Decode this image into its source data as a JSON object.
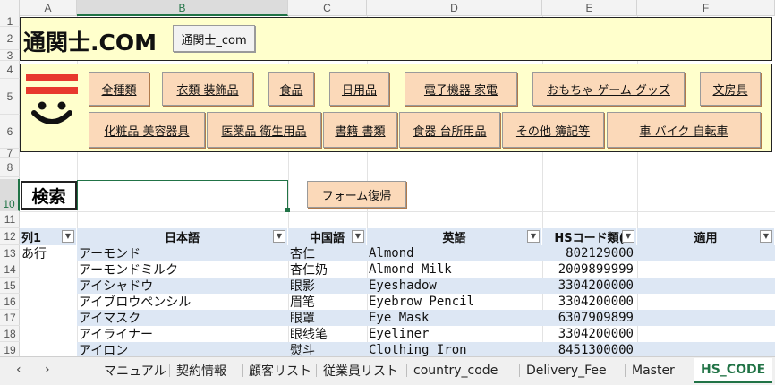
{
  "columns": [
    "A",
    "B",
    "C",
    "D",
    "E",
    "F"
  ],
  "rows": [
    "1",
    "2",
    "3",
    "4",
    "5",
    "6",
    "7",
    "8",
    "9",
    "10",
    "11",
    "12",
    "13",
    "14",
    "15",
    "16",
    "17",
    "18",
    "19"
  ],
  "header_panel": {
    "brand": "通関士.COM",
    "link_button": "通関士_com"
  },
  "categories": {
    "row1": [
      "全種類",
      "衣類 装飾品",
      "食品",
      "日用品",
      "電子機器 家電",
      "おもちゃ ゲーム グッズ",
      "文房具"
    ],
    "row2": [
      "化粧品 美容器具",
      "医薬品 衛生用品",
      "書籍 書類",
      "食器 台所用品",
      "その他 簿記等",
      "車 バイク 自転車"
    ]
  },
  "search": {
    "label": "検索",
    "value": "",
    "reset_button": "フォーム復帰"
  },
  "table": {
    "headers": [
      "列1",
      "日本語",
      "中国語",
      "英語",
      "HSコード類(",
      "適用"
    ],
    "rows": [
      [
        "あ行",
        "アーモンド",
        "杏仁",
        "Almond",
        "802129000",
        ""
      ],
      [
        "",
        "アーモンドミルク",
        "杏仁奶",
        "Almond Milk",
        "2009899999",
        ""
      ],
      [
        "",
        "アイシャドウ",
        "眼影",
        "Eyeshadow",
        "3304200000",
        ""
      ],
      [
        "",
        "アイブロウペンシル",
        "眉笔",
        "Eyebrow Pencil",
        "3304200000",
        ""
      ],
      [
        "",
        "アイマスク",
        "眼罩",
        "Eye Mask",
        "6307909899",
        ""
      ],
      [
        "",
        "アイライナー",
        "眼线笔",
        "Eyeliner",
        "3304200000",
        ""
      ],
      [
        "",
        "アイロン",
        "熨斗",
        "Clothing Iron",
        "8451300000",
        ""
      ]
    ]
  },
  "sheet_tabs": [
    "マニュアル",
    "契約情報",
    "顧客リスト",
    "従業員リスト",
    "country_code",
    "Delivery_Fee",
    "Master",
    "HS_CODE"
  ],
  "active_tab": "HS_CODE",
  "colors": {
    "panel": "#ffffcc",
    "button": "#fbd9b9",
    "band": "#dde7f4",
    "accent": "#217346",
    "logo_red": "#e8382d"
  }
}
